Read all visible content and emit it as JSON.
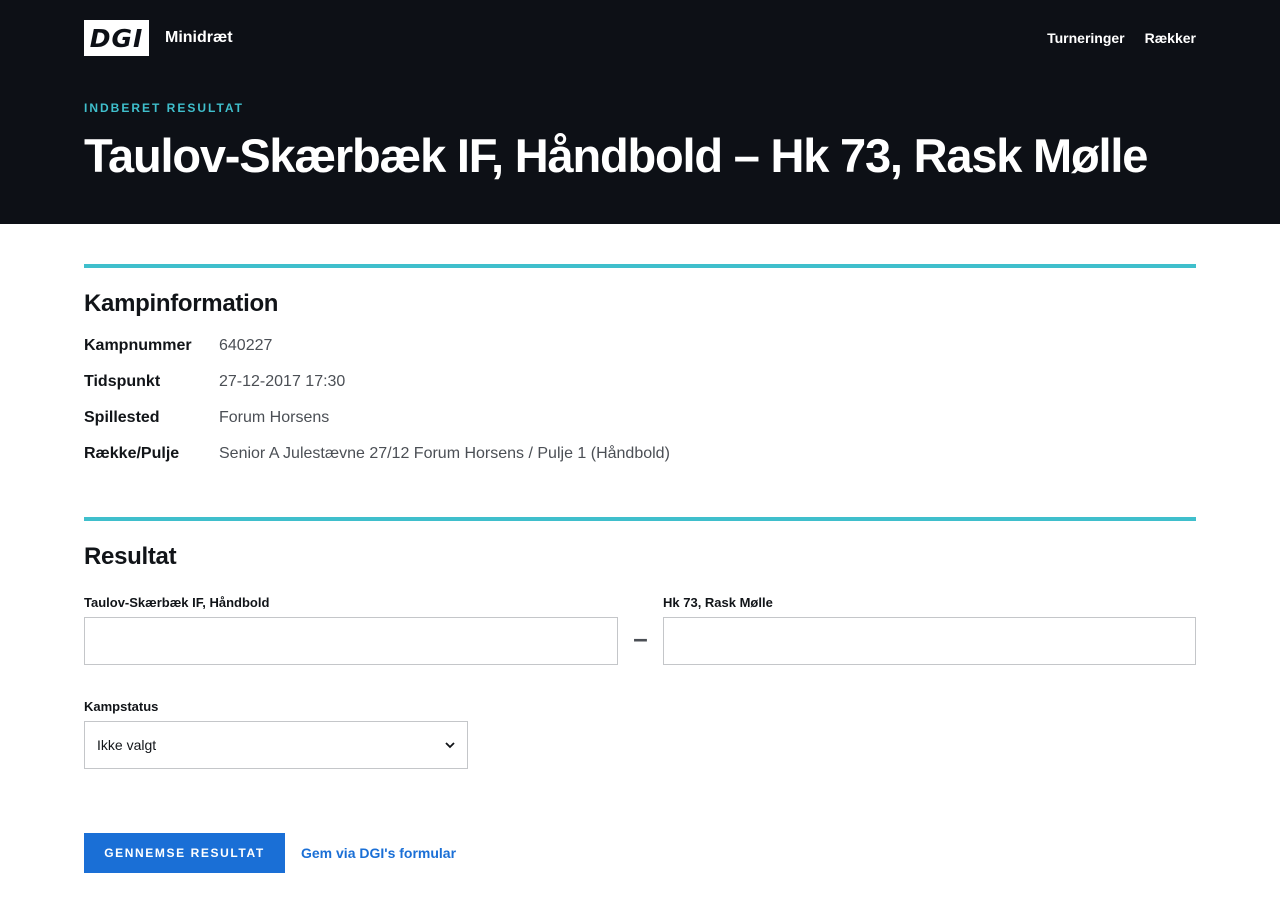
{
  "header": {
    "logo_text": "DGI",
    "app_name": "Minidræt",
    "nav": [
      "Turneringer",
      "Rækker"
    ]
  },
  "hero": {
    "eyebrow": "INDBERET RESULTAT",
    "title": "Taulov-Skærbæk IF, Håndbold – Hk 73, Rask Mølle"
  },
  "match_info": {
    "title": "Kampinformation",
    "rows": [
      {
        "label": "Kampnummer",
        "value": "640227"
      },
      {
        "label": "Tidspunkt",
        "value": "27-12-2017 17:30"
      },
      {
        "label": "Spillested",
        "value": "Forum Horsens"
      },
      {
        "label": "Række/Pulje",
        "value": "Senior A Julestævne 27/12 Forum Horsens / Pulje 1 (Håndbold)"
      }
    ]
  },
  "result": {
    "title": "Resultat",
    "home_label": "Taulov-Skærbæk IF, Håndbold",
    "home_value": "",
    "separator": "–",
    "away_label": "Hk 73, Rask Mølle",
    "away_value": "",
    "status_label": "Kampstatus",
    "status_value": "Ikke valgt"
  },
  "actions": {
    "primary": "GENNEMSE RESULTAT",
    "secondary": "Gem via DGI's formular"
  },
  "colors": {
    "hero_bg": "#0d1016",
    "accent": "#3fbfcc",
    "primary": "#1a6fd6"
  }
}
